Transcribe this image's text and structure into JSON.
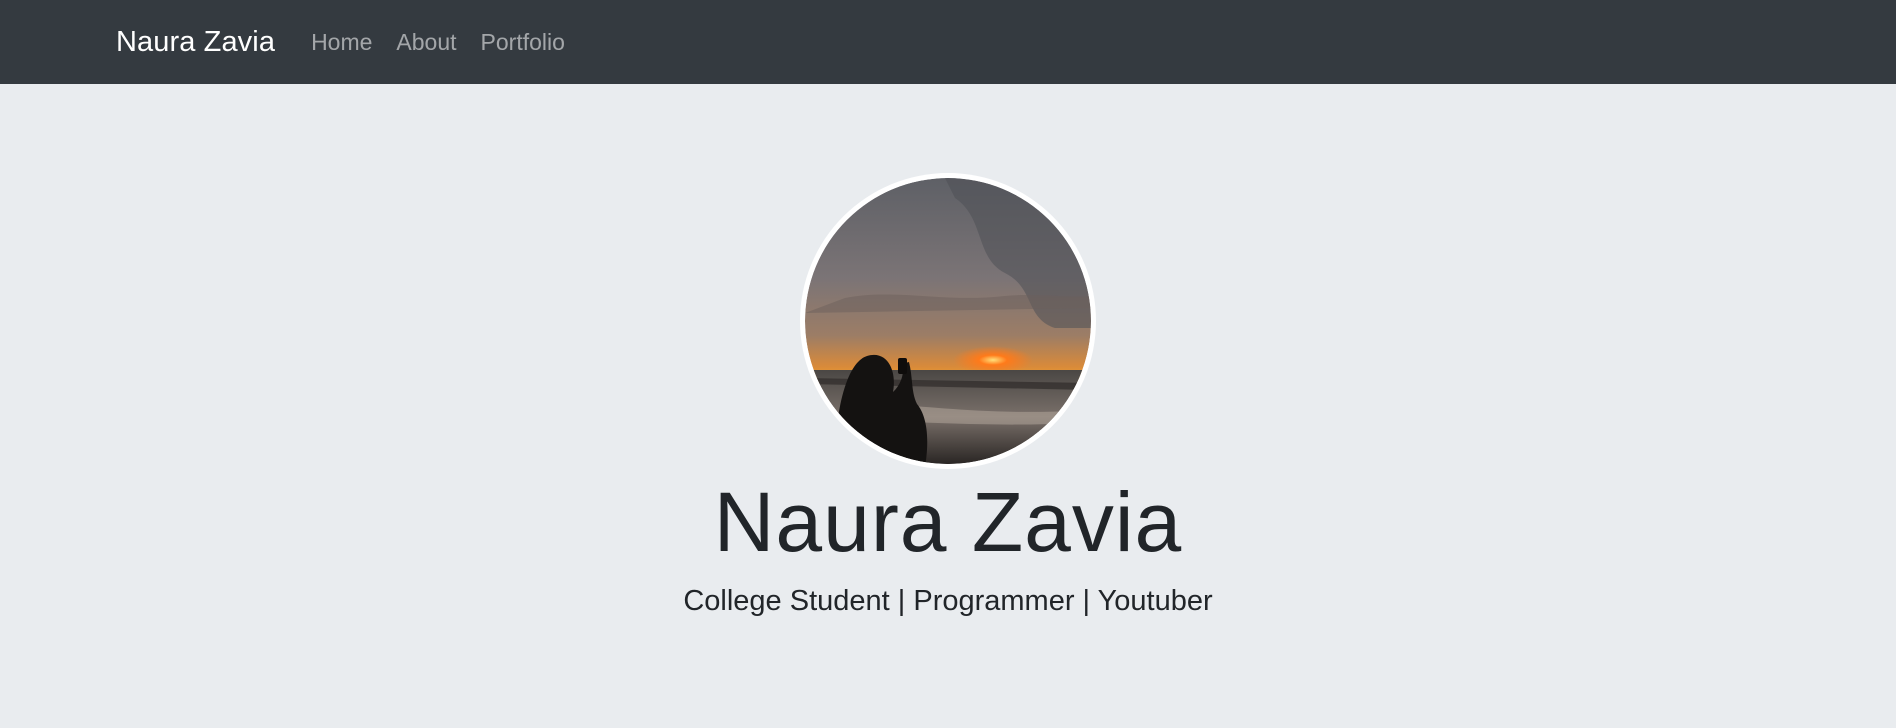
{
  "navbar": {
    "brand": "Naura Zavia",
    "links": [
      {
        "label": "Home"
      },
      {
        "label": "About"
      },
      {
        "label": "Portfolio"
      }
    ],
    "background": "#343a40"
  },
  "hero": {
    "name": "Naura Zavia",
    "tagline": "College Student | Programmer | Youtuber",
    "background": "#e9ecef",
    "avatar_description": "sunset-beach-photo"
  }
}
